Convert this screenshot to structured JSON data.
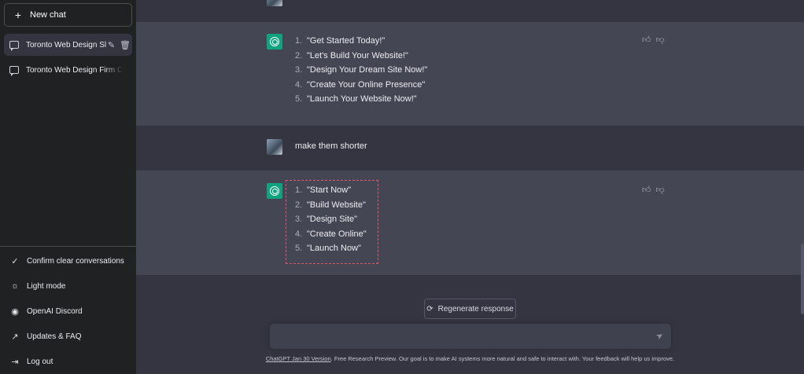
{
  "sidebar": {
    "new_chat": "New chat",
    "conversations": [
      {
        "title": "Toronto Web Design Sl",
        "active": true
      },
      {
        "title": "Toronto Web Design Firm CTA",
        "active": false
      }
    ],
    "bottom": [
      {
        "label": "Confirm clear conversations",
        "icon": "check-icon"
      },
      {
        "label": "Light mode",
        "icon": "sun-icon"
      },
      {
        "label": "OpenAI Discord",
        "icon": "discord-icon"
      },
      {
        "label": "Updates & FAQ",
        "icon": "external-link-icon"
      },
      {
        "label": "Log out",
        "icon": "logout-icon"
      }
    ]
  },
  "messages": {
    "first_reply": [
      {
        "n": "1.",
        "text": "\"Get Started Today!\""
      },
      {
        "n": "2.",
        "text": "\"Let's Build Your Website!\""
      },
      {
        "n": "3.",
        "text": "\"Design Your Dream Site Now!\""
      },
      {
        "n": "4.",
        "text": "\"Create Your Online Presence\""
      },
      {
        "n": "5.",
        "text": "\"Launch Your Website Now!\""
      }
    ],
    "user_prompt": "make them shorter",
    "second_reply": [
      {
        "n": "1.",
        "text": "\"Start Now\""
      },
      {
        "n": "2.",
        "text": "\"Build Website\""
      },
      {
        "n": "3.",
        "text": "\"Design Site\""
      },
      {
        "n": "4.",
        "text": "\"Create Online\""
      },
      {
        "n": "5.",
        "text": "\"Launch Now\""
      }
    ]
  },
  "composer": {
    "regenerate": "Regenerate response",
    "placeholder": ""
  },
  "footer": {
    "link": "ChatGPT Jan 30 Version",
    "text": ". Free Research Preview. Our goal is to make AI systems more natural and safe to interact with. Your feedback will help us improve."
  },
  "colors": {
    "sidebar_bg": "#202123",
    "main_bg": "#343541",
    "assistant_bg": "#444654",
    "gpt_green": "#10a37f",
    "highlight": "#e0566a"
  }
}
